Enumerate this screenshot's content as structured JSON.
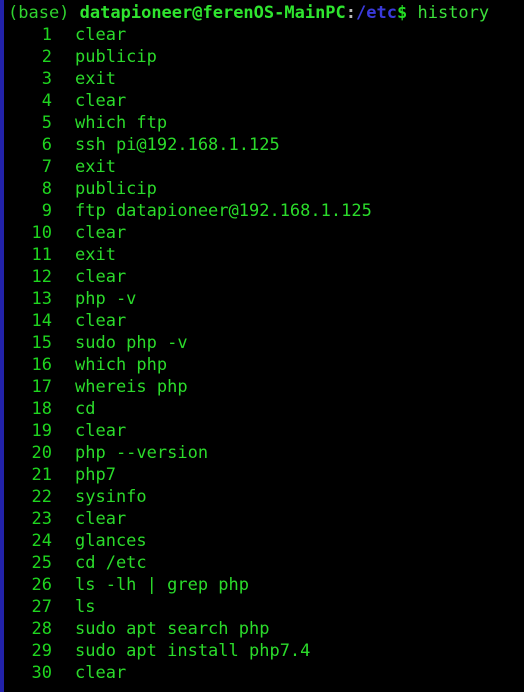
{
  "terminal": {
    "background_color": "#000000",
    "left_edge_color": "#2222AA",
    "foreground_color": "#2BDB2B",
    "path_color": "#3A3ADB"
  },
  "prompt": {
    "conda_env": "(base)",
    "user_host": "datapioneer@ferenOS-MainPC",
    "separator": ":",
    "path": "/etc",
    "symbol": "$",
    "command": "history"
  },
  "history": [
    {
      "index": "1",
      "command": "clear"
    },
    {
      "index": "2",
      "command": "publicip"
    },
    {
      "index": "3",
      "command": "exit"
    },
    {
      "index": "4",
      "command": "clear"
    },
    {
      "index": "5",
      "command": "which ftp"
    },
    {
      "index": "6",
      "command": "ssh pi@192.168.1.125"
    },
    {
      "index": "7",
      "command": "exit"
    },
    {
      "index": "8",
      "command": "publicip"
    },
    {
      "index": "9",
      "command": "ftp datapioneer@192.168.1.125"
    },
    {
      "index": "10",
      "command": "clear"
    },
    {
      "index": "11",
      "command": "exit"
    },
    {
      "index": "12",
      "command": "clear"
    },
    {
      "index": "13",
      "command": "php -v"
    },
    {
      "index": "14",
      "command": "clear"
    },
    {
      "index": "15",
      "command": "sudo php -v"
    },
    {
      "index": "16",
      "command": "which php"
    },
    {
      "index": "17",
      "command": "whereis php"
    },
    {
      "index": "18",
      "command": "cd"
    },
    {
      "index": "19",
      "command": "clear"
    },
    {
      "index": "20",
      "command": "php --version"
    },
    {
      "index": "21",
      "command": "php7"
    },
    {
      "index": "22",
      "command": "sysinfo"
    },
    {
      "index": "23",
      "command": "clear"
    },
    {
      "index": "24",
      "command": "glances"
    },
    {
      "index": "25",
      "command": "cd /etc"
    },
    {
      "index": "26",
      "command": "ls -lh | grep php"
    },
    {
      "index": "27",
      "command": "ls"
    },
    {
      "index": "28",
      "command": "sudo apt search php"
    },
    {
      "index": "29",
      "command": "sudo apt install php7.4"
    },
    {
      "index": "30",
      "command": "clear"
    }
  ]
}
